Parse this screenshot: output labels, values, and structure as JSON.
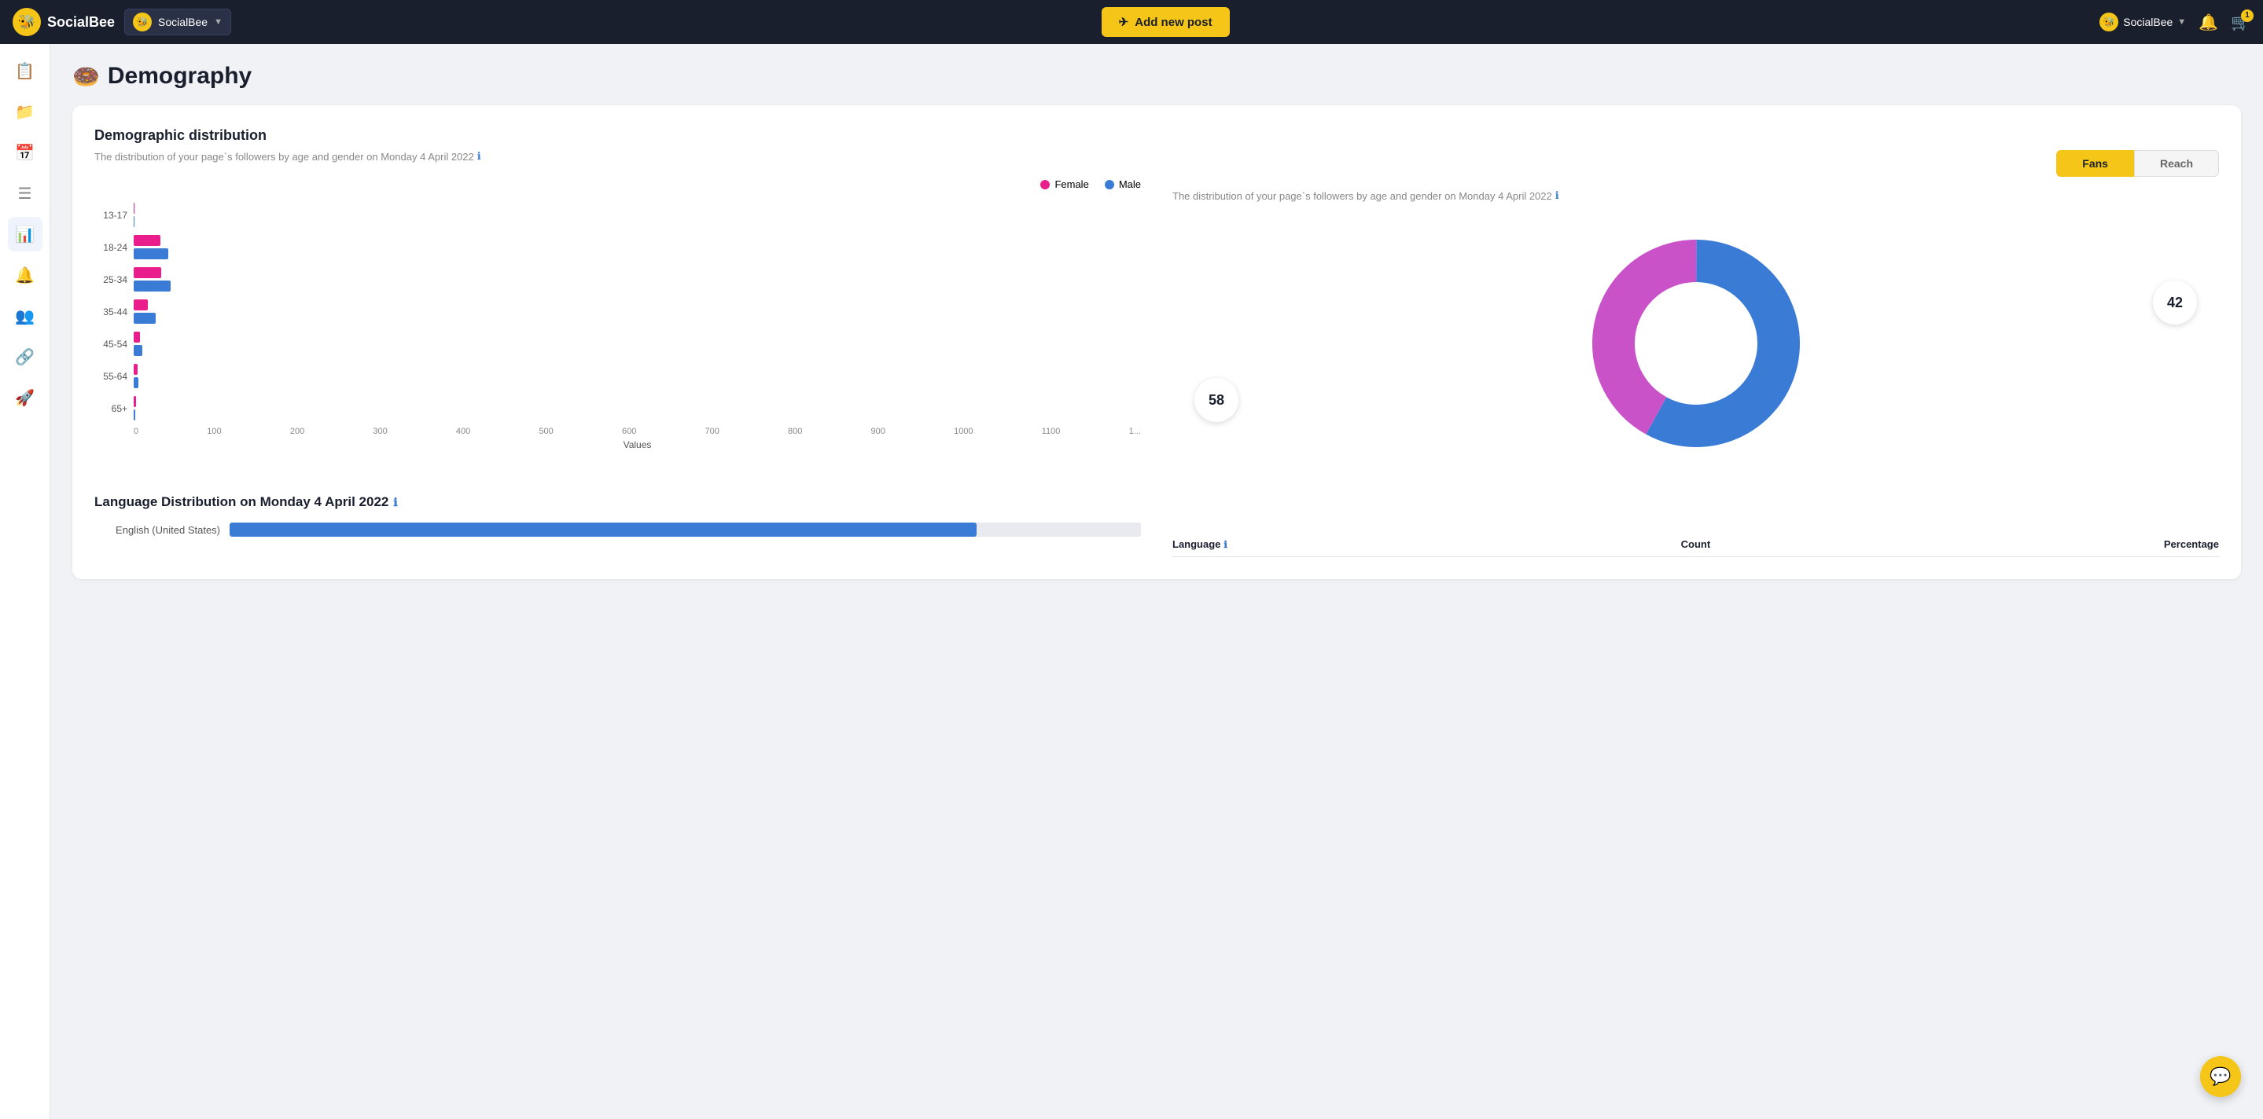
{
  "topnav": {
    "logo_text": "SocialBee",
    "logo_emoji": "🐝",
    "account_label": "SocialBee",
    "add_post_label": "Add new post",
    "user_label": "SocialBee",
    "notif_count": "",
    "cart_count": "1"
  },
  "sidebar": {
    "items": [
      {
        "name": "clipboard",
        "icon": "📋",
        "active": false
      },
      {
        "name": "folder",
        "icon": "📁",
        "active": false
      },
      {
        "name": "calendar",
        "icon": "📅",
        "active": false
      },
      {
        "name": "list",
        "icon": "☰",
        "active": false
      },
      {
        "name": "analytics",
        "icon": "📊",
        "active": true
      },
      {
        "name": "bell",
        "icon": "🔔",
        "active": false
      },
      {
        "name": "users",
        "icon": "👥",
        "active": false
      },
      {
        "name": "link",
        "icon": "🔗",
        "active": false
      },
      {
        "name": "rocket",
        "icon": "🚀",
        "active": false
      }
    ]
  },
  "page": {
    "title": "Demography",
    "icon": "🍩"
  },
  "demographic_distribution": {
    "title": "Demographic distribution",
    "subtitle": "The distribution of your page`s followers by age and gender on Monday 4 April 2022",
    "legend": {
      "female_label": "Female",
      "male_label": "Male",
      "female_color": "#e91e8c",
      "male_color": "#3a7bd5"
    },
    "bars": [
      {
        "age": "13-17",
        "female": 1,
        "male": 2
      },
      {
        "age": "18-24",
        "female": 72,
        "male": 93
      },
      {
        "age": "25-34",
        "female": 74,
        "male": 98
      },
      {
        "age": "35-44",
        "female": 38,
        "male": 58
      },
      {
        "age": "45-54",
        "female": 17,
        "male": 22
      },
      {
        "age": "55-64",
        "female": 10,
        "male": 12
      },
      {
        "age": "65+",
        "female": 6,
        "male": 5
      }
    ],
    "x_axis_labels": [
      "0",
      "100",
      "200",
      "300",
      "400",
      "500",
      "600",
      "700",
      "800",
      "900",
      "1000",
      "1100",
      "1..."
    ],
    "x_axis_title": "Values"
  },
  "donut_chart": {
    "tabs": [
      "Fans",
      "Reach"
    ],
    "active_tab": "Fans",
    "subtitle": "The distribution of your page`s followers by age and gender on Monday 4 April 2022",
    "male_pct": 58,
    "female_pct": 42,
    "male_color": "#3a7bd5",
    "female_color": "#c952c9"
  },
  "language_section": {
    "title": "Language Distribution on Monday 4 April 2022",
    "bar_item": {
      "label": "English (United States)",
      "fill_pct": 82
    },
    "table": {
      "col_language": "Language",
      "col_count": "Count",
      "col_percentage": "Percentage"
    }
  }
}
